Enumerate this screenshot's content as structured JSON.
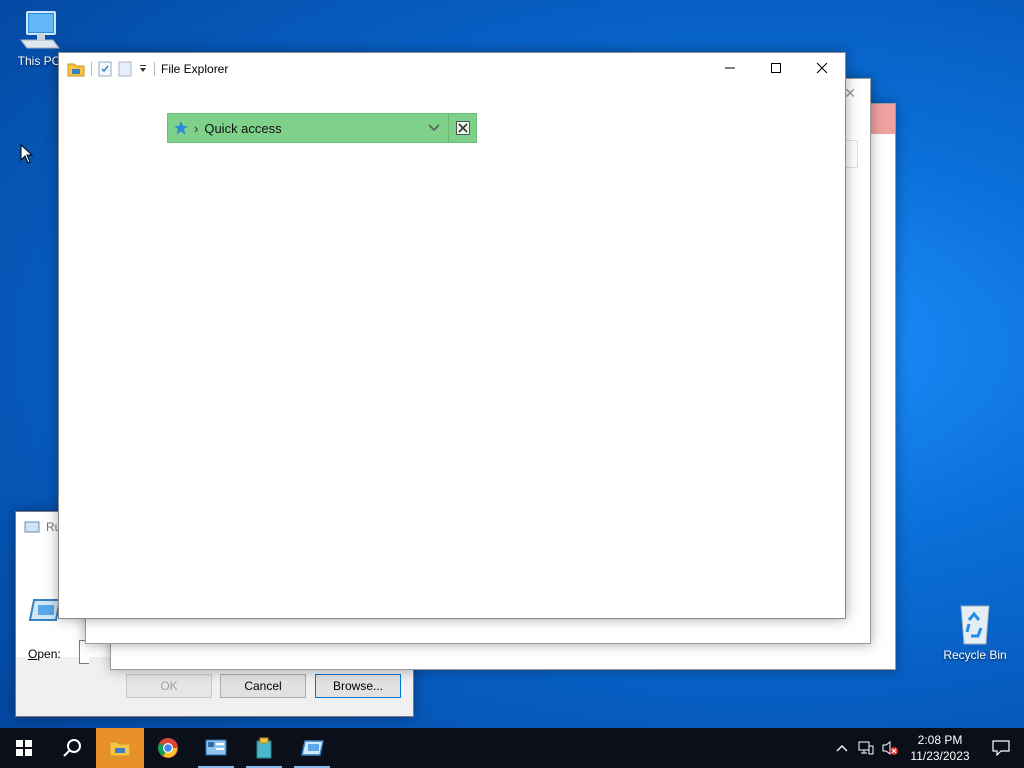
{
  "desktop": {
    "icons": [
      {
        "label": "This PC"
      },
      {
        "label": "Recycle Bin"
      }
    ]
  },
  "run_dialog": {
    "title": "Ru",
    "open_label_underlined": "O",
    "open_label_rest": "pen:",
    "buttons": {
      "ok": "OK",
      "cancel": "Cancel",
      "browse": "Browse..."
    }
  },
  "file_explorer": {
    "title": "File Explorer",
    "address_bar": {
      "location": "Quick access"
    }
  },
  "taskbar": {
    "apps": [
      {
        "name": "file-explorer",
        "active": true
      },
      {
        "name": "chrome"
      },
      {
        "name": "control-panel",
        "running": true
      },
      {
        "name": "archive-app",
        "running": true
      },
      {
        "name": "run-app",
        "running": true
      }
    ],
    "clock": {
      "time": "2:08 PM",
      "date": "11/23/2023"
    }
  },
  "colors": {
    "desktop_blue": "#0a6fd8",
    "address_highlight": "#7fd18a",
    "taskbar_bg": "#0a0f1a",
    "active_app": "#e8902a"
  }
}
